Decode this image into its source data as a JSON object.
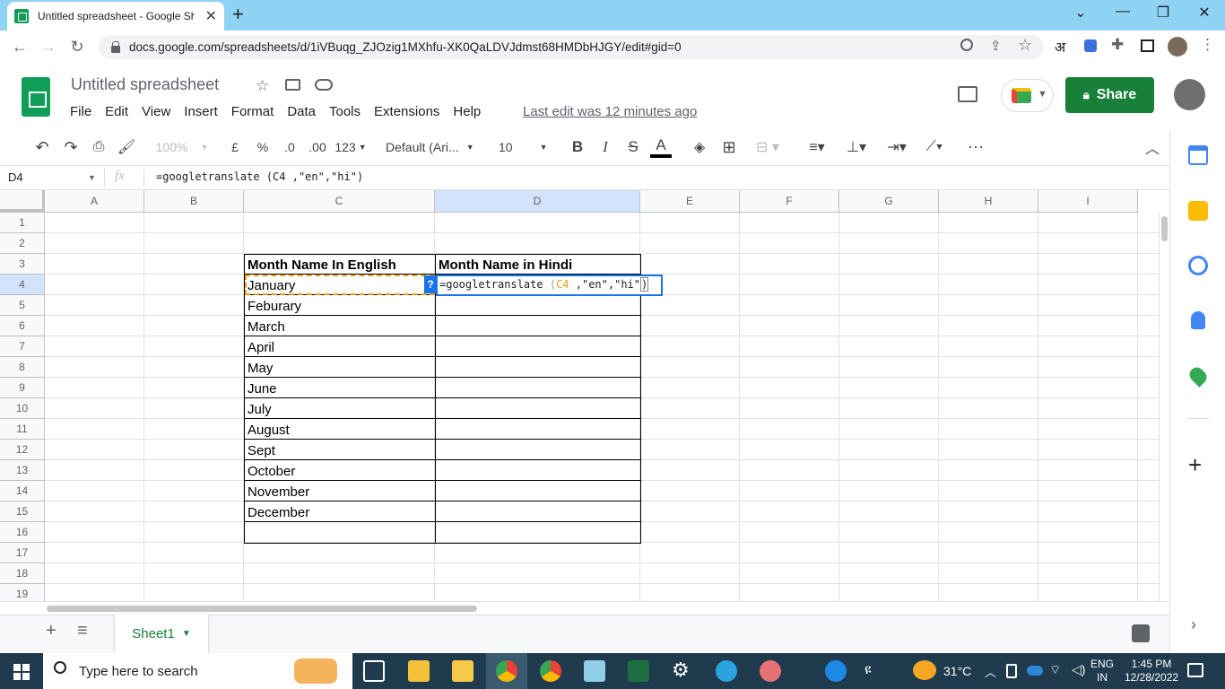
{
  "browser": {
    "tab_title": "Untitled spreadsheet - Google Sh",
    "url": "docs.google.com/spreadsheets/d/1iVBuqg_ZJOzig1MXhfu-XK0QaLDVJdmst68HMDbHJGY/edit#gid=0",
    "ext_letter": "अ"
  },
  "sheets": {
    "title": "Untitled spreadsheet",
    "menu": [
      "File",
      "Edit",
      "View",
      "Insert",
      "Format",
      "Data",
      "Tools",
      "Extensions",
      "Help"
    ],
    "last_edit": "Last edit was 12 minutes ago",
    "share_label": "Share"
  },
  "toolbar": {
    "zoom": "100%",
    "currency": "£",
    "percent": "%",
    "dec_less": ".0",
    "dec_more": ".00",
    "more_formats": "123",
    "font": "Default (Ari...",
    "font_size": "10",
    "bold": "B",
    "italic": "I",
    "strike": "S",
    "text_color": "A"
  },
  "formula_bar": {
    "name_box": "D4",
    "fx": "fx",
    "formula": "=googletranslate (C4 ,\"en\",\"hi\")"
  },
  "grid": {
    "columns": [
      "A",
      "B",
      "C",
      "D",
      "E",
      "F",
      "G",
      "H",
      "I"
    ],
    "rows": [
      "1",
      "2",
      "3",
      "4",
      "5",
      "6",
      "7",
      "8",
      "9",
      "10",
      "11",
      "12",
      "13",
      "14",
      "15",
      "16",
      "17",
      "18",
      "19"
    ],
    "header_c": "Month Name In English",
    "header_d": "Month Name in Hindi",
    "months": [
      "January",
      "Feburary",
      "March",
      "April",
      "May",
      "June",
      "July",
      "August",
      "Sept",
      "October",
      "November",
      "December"
    ],
    "editor": {
      "prefix": "=googletranslate ",
      "paren_open": "(",
      "ref": "C4",
      "args": " ,\"en\",\"hi\"",
      "paren_close": ")",
      "help": "?"
    }
  },
  "sheet_tabs": {
    "add": "+",
    "list": "≡",
    "active_sheet": "Sheet1"
  },
  "taskbar": {
    "search_placeholder": "Type here to search",
    "temperature": "31°C",
    "lang_line1": "ENG",
    "lang_line2": "IN",
    "time": "1:45 PM",
    "date": "12/28/2022"
  },
  "colors": {
    "sheets_green": "#188038",
    "tab_strip": "#8ed3f3",
    "taskbar": "#1f3b4d",
    "selection_blue": "#1a73e8",
    "copy_orange": "#f39c12"
  }
}
